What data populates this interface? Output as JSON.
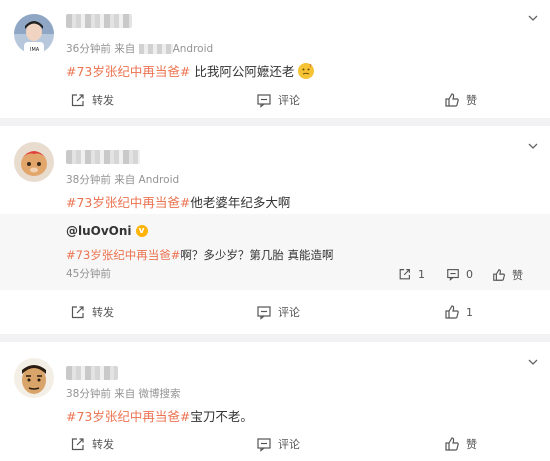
{
  "posts": [
    {
      "time": "36分钟前",
      "source": "来自 ",
      "source_app": "Android",
      "topic": "#73岁张纪中再当爸#",
      "text": " 比我阿公阿嬷还老",
      "actions": {
        "repost": "转发",
        "comment": "评论",
        "like": "赞"
      }
    },
    {
      "time": "38分钟前",
      "source": "来自 Android",
      "topic": "#73岁张纪中再当爸#",
      "text": "他老婆年纪多大啊",
      "quote": {
        "author": "@luOvOni",
        "topic": "#73岁张纪中再当爸#",
        "text": "啊？多少岁？第几胎 真能造啊",
        "time": "45分钟前",
        "repost_count": "1",
        "comment_count": "0",
        "like_label": "赞"
      },
      "actions": {
        "repost": "转发",
        "comment": "评论",
        "like": "1"
      }
    },
    {
      "time": "38分钟前",
      "source": "来自 微博搜索",
      "topic": "#73岁张纪中再当爸#",
      "text": "宝刀不老。",
      "actions": {
        "repost": "转发",
        "comment": "评论",
        "like": "赞"
      }
    }
  ],
  "icons": {
    "menu": "chevron-down-icon",
    "repost": "repost-icon",
    "comment": "comment-icon",
    "like": "thumbs-up-icon",
    "emoji": "thinking-face-emoji",
    "verified": "verified-badge-icon"
  },
  "colors": {
    "topic": "#eb7350",
    "separator": "#f2f2f5",
    "quote_bg": "#f7f7f7"
  }
}
